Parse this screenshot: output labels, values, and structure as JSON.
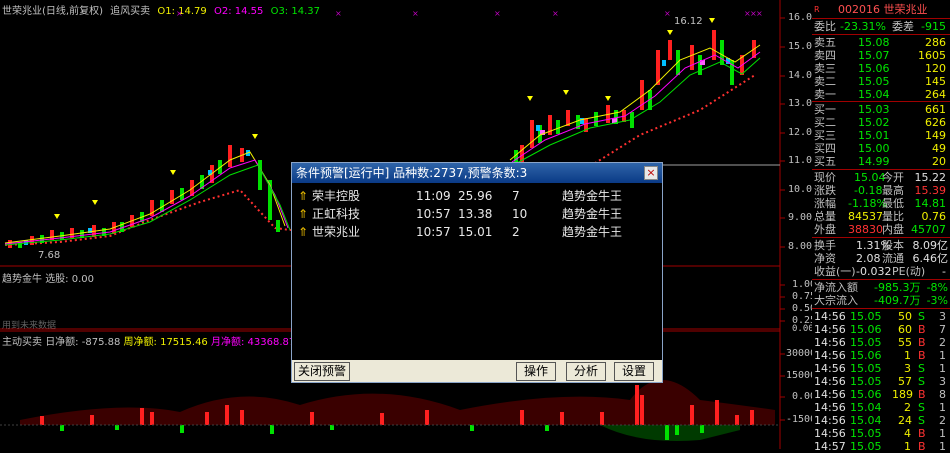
{
  "header": {
    "title": "世荣兆业(日线,前复权)",
    "indicator": "追风买卖",
    "o1": "O1: 14.79",
    "o2": "O2: 14.55",
    "o3": "O3: 14.37",
    "colors": {
      "o1": "#f0f000",
      "o2": "#ff00ff",
      "o3": "#00e600"
    }
  },
  "main_chart": {
    "y_ticks": [
      "16.00",
      "15.00",
      "14.00",
      "13.00",
      "12.00",
      "11.00",
      "10.00",
      "9.00",
      "8.00"
    ],
    "high_label": "16.12",
    "low_label": "7.68"
  },
  "sub1": {
    "label": "趋势金牛",
    "value": "选股: 0.00",
    "y_ticks": [
      "1.00",
      "0.75",
      "0.50",
      "0.25",
      "0.00"
    ],
    "footer_note": "用到未来数据"
  },
  "sub2": {
    "label": "主动买卖",
    "day": "日净额: -875.88",
    "week": "周净额: 17515.46",
    "month": "月净额: 43368.87",
    "y_ticks": [
      "30000",
      "15000",
      "0.00",
      "-15000"
    ],
    "colors": {
      "week": "#f0f000",
      "month": "#ff00ff"
    }
  },
  "dialog": {
    "title": "条件预警[运行中] 品种数:2737,预警条数:3",
    "close_label": "×",
    "rows": [
      {
        "name": "荣丰控股",
        "time": "11:09",
        "price": "25.96",
        "num": "7",
        "cond": "趋势金牛王"
      },
      {
        "name": "正虹科技",
        "time": "10:57",
        "price": "13.38",
        "num": "10",
        "cond": "趋势金牛王"
      },
      {
        "name": "世荣兆业",
        "time": "10:57",
        "price": "15.01",
        "num": "2",
        "cond": "趋势金牛王"
      }
    ],
    "buttons": {
      "close_alert": "关闭预警",
      "operate": "操作",
      "analyze": "分析",
      "settings": "设置"
    }
  },
  "quote": {
    "r_mark": "R",
    "code_name": "002016 世荣兆业",
    "weibi_label": "委比",
    "weibi_value": "-23.31%",
    "weicha_label": "委差",
    "weicha_value": "-915",
    "sells": [
      {
        "label": "卖五",
        "price": "15.08",
        "vol": "286"
      },
      {
        "label": "卖四",
        "price": "15.07",
        "vol": "1605"
      },
      {
        "label": "卖三",
        "price": "15.06",
        "vol": "120"
      },
      {
        "label": "卖二",
        "price": "15.05",
        "vol": "145"
      },
      {
        "label": "卖一",
        "price": "15.04",
        "vol": "264"
      }
    ],
    "buys": [
      {
        "label": "买一",
        "price": "15.03",
        "vol": "661"
      },
      {
        "label": "买二",
        "price": "15.02",
        "vol": "626"
      },
      {
        "label": "买三",
        "price": "15.01",
        "vol": "149"
      },
      {
        "label": "买四",
        "price": "15.00",
        "vol": "49"
      },
      {
        "label": "买五",
        "price": "14.99",
        "vol": "20"
      }
    ],
    "stats": [
      {
        "l1": "现价",
        "v1": "15.04",
        "l2": "今开",
        "v2": "15.22"
      },
      {
        "l1": "涨跌",
        "v1": "-0.18",
        "l2": "最高",
        "v2": "15.39"
      },
      {
        "l1": "涨幅",
        "v1": "-1.18%",
        "l2": "最低",
        "v2": "14.81"
      },
      {
        "l1": "总量",
        "v1": "84537",
        "l2": "量比",
        "v2": "0.76"
      },
      {
        "l1": "外盘",
        "v1": "38830",
        "l2": "内盘",
        "v2": "45707"
      }
    ],
    "extra": [
      {
        "l1": "换手",
        "v1": "1.31%",
        "l2": "股本",
        "v2": "8.09亿"
      },
      {
        "l1": "净资",
        "v1": "2.08",
        "l2": "流通",
        "v2": "6.46亿"
      },
      {
        "l1": "收益(一)",
        "v1": "-0.032",
        "l2": "PE(动)",
        "v2": "-"
      }
    ],
    "flow": [
      {
        "label": "净流入额",
        "v1": "-985.3万",
        "v2": "-8%"
      },
      {
        "label": "大宗流入",
        "v1": "-409.7万",
        "v2": "-3%"
      }
    ],
    "ticks": [
      {
        "t": "14:56",
        "p": "15.05",
        "v": "50",
        "s": "S",
        "n": "3"
      },
      {
        "t": "14:56",
        "p": "15.06",
        "v": "60",
        "s": "B",
        "n": "7"
      },
      {
        "t": "14:56",
        "p": "15.05",
        "v": "55",
        "s": "B",
        "n": "2"
      },
      {
        "t": "14:56",
        "p": "15.06",
        "v": "1",
        "s": "B",
        "n": "1"
      },
      {
        "t": "14:56",
        "p": "15.05",
        "v": "3",
        "s": "S",
        "n": "1"
      },
      {
        "t": "14:56",
        "p": "15.05",
        "v": "57",
        "s": "S",
        "n": "3"
      },
      {
        "t": "14:56",
        "p": "15.06",
        "v": "189",
        "s": "B",
        "n": "8"
      },
      {
        "t": "14:56",
        "p": "15.04",
        "v": "2",
        "s": "S",
        "n": "1"
      },
      {
        "t": "14:56",
        "p": "15.04",
        "v": "24",
        "s": "S",
        "n": "2"
      },
      {
        "t": "14:56",
        "p": "15.05",
        "v": "4",
        "s": "B",
        "n": "1"
      },
      {
        "t": "14:57",
        "p": "15.05",
        "v": "1",
        "s": "B",
        "n": "1"
      }
    ]
  }
}
